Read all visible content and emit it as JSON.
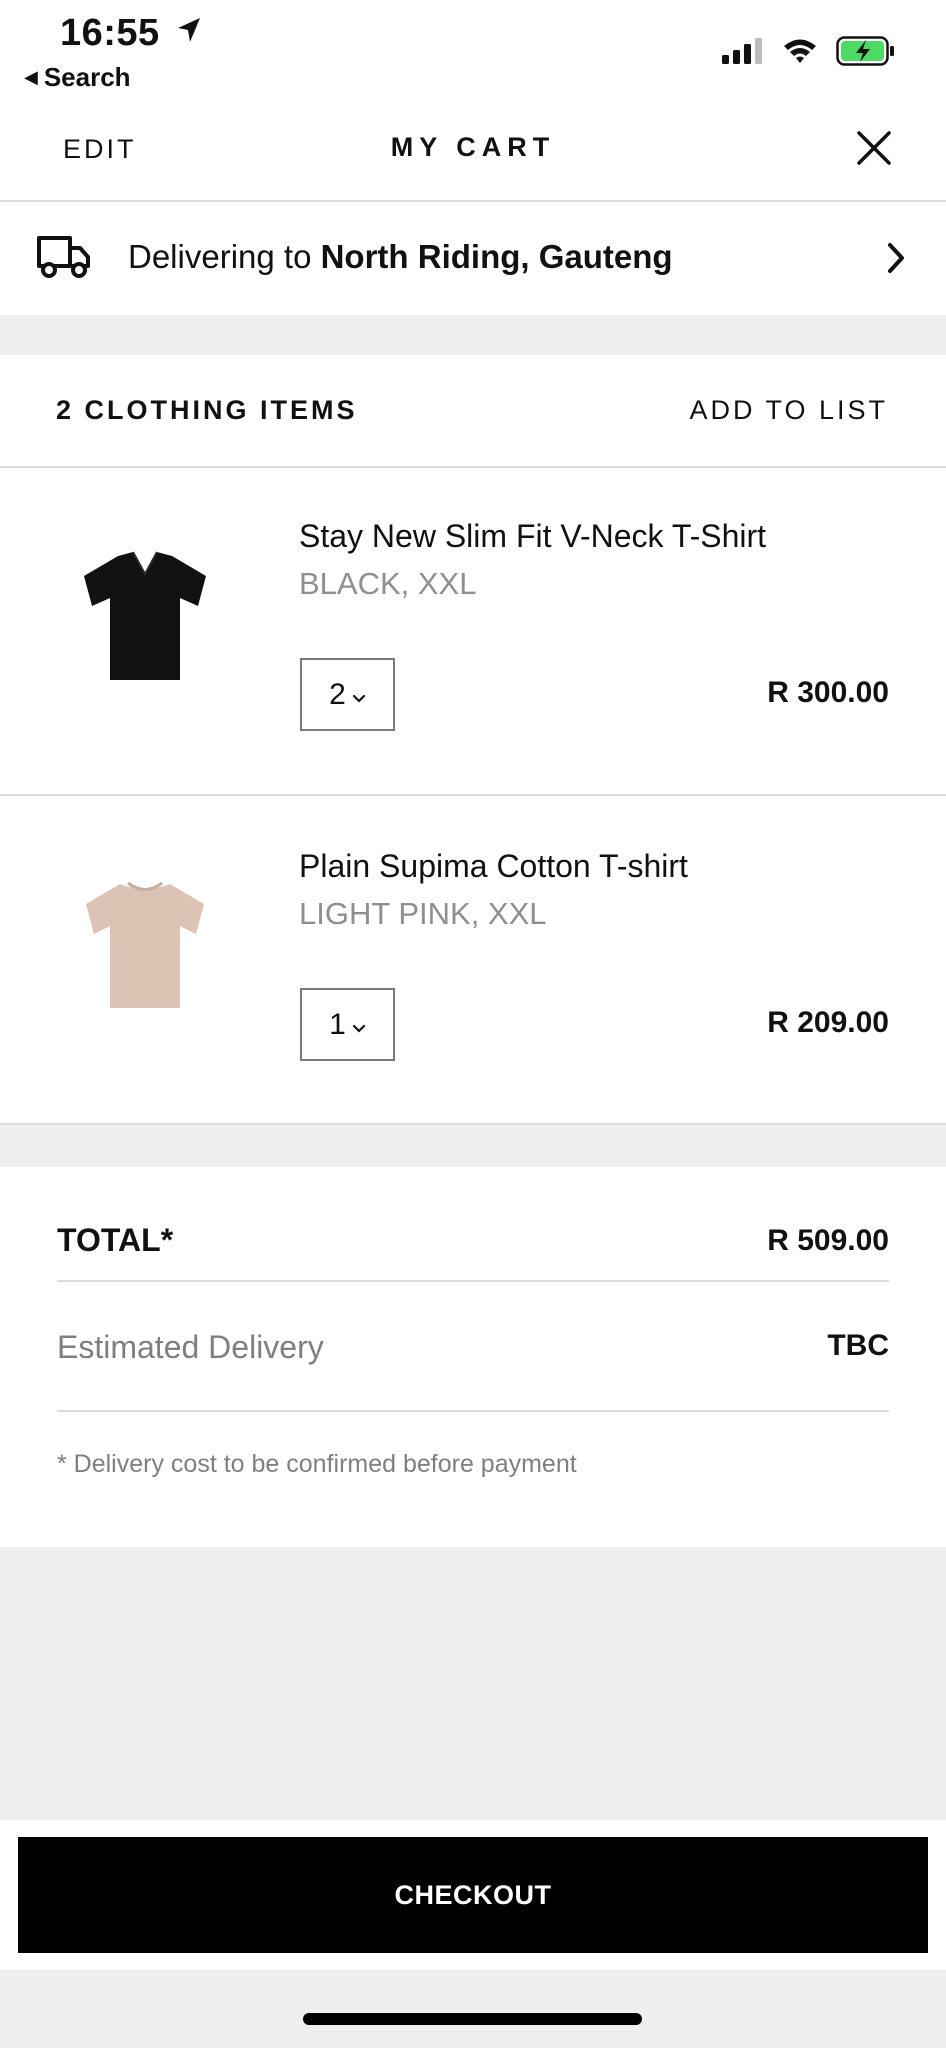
{
  "status": {
    "time": "16:55",
    "back_label": "Search",
    "battery_color": "#4cd964"
  },
  "header": {
    "edit_label": "EDIT",
    "title": "MY CART"
  },
  "delivery": {
    "prefix": "Delivering to",
    "location": "North Riding, Gauteng"
  },
  "items_section": {
    "count_label": "2 CLOTHING ITEMS",
    "add_to_list_label": "ADD TO LIST"
  },
  "items": [
    {
      "name": "Stay New Slim Fit V-Neck T-Shirt",
      "variant": "BLACK, XXL",
      "quantity": "2",
      "price": "R 300.00",
      "thumb_color": "#111111",
      "thumb_icon": "black-vneck-tshirt"
    },
    {
      "name": "Plain Supima Cotton T-shirt",
      "variant": "LIGHT PINK, XXL",
      "quantity": "1",
      "price": "R 209.00",
      "thumb_color": "#dcc3b3",
      "thumb_icon": "pink-crewneck-tshirt"
    }
  ],
  "totals": {
    "total_label": "TOTAL*",
    "total_value": "R 509.00",
    "est_label": "Estimated Delivery",
    "est_value": "TBC",
    "note": "* Delivery cost to be confirmed before payment"
  },
  "checkout": {
    "label": "CHECKOUT"
  }
}
